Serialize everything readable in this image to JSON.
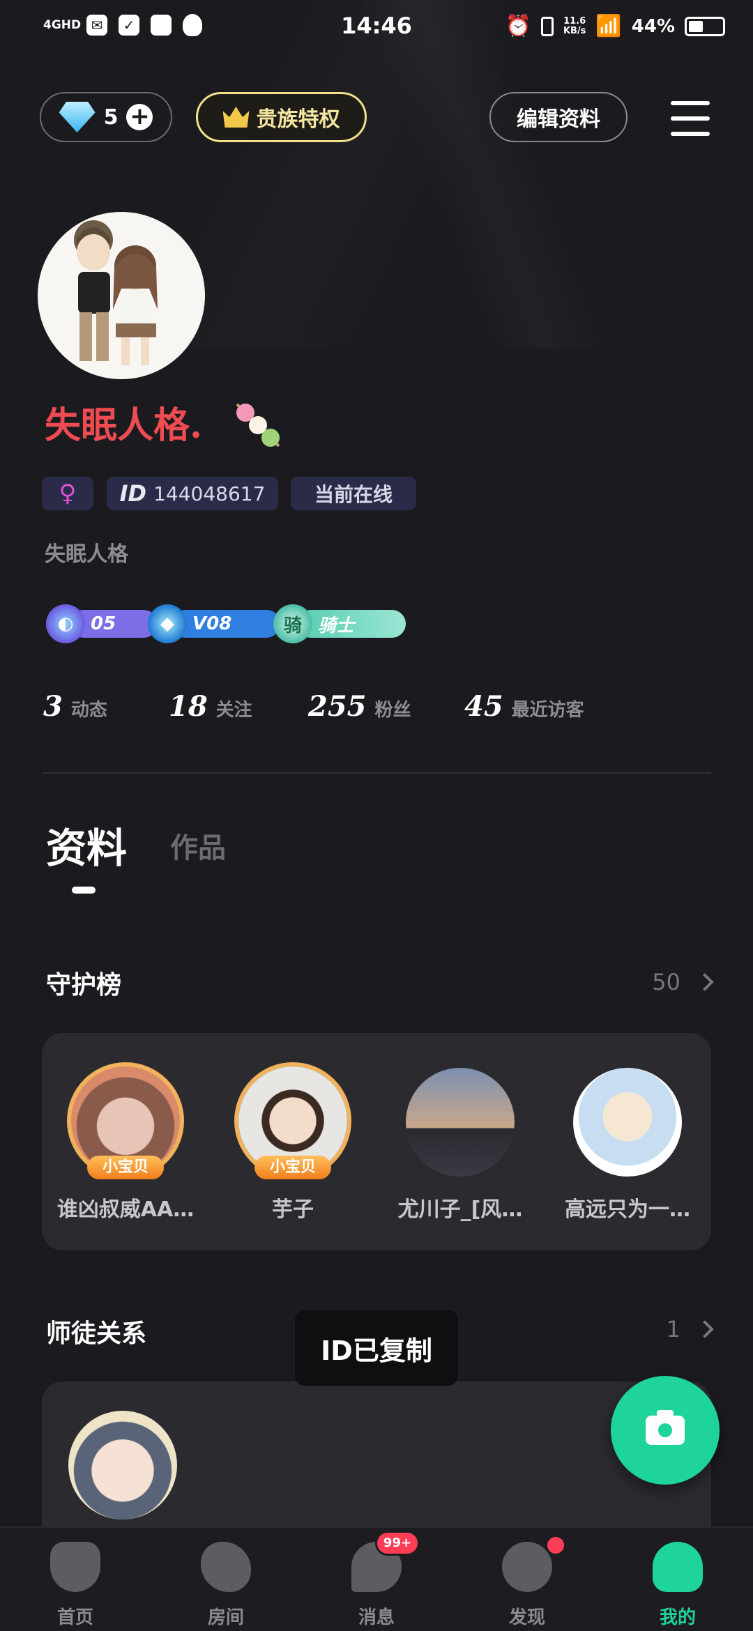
{
  "status_bar": {
    "network": "4GHD",
    "time": "14:46",
    "speed_value": "11.6",
    "speed_unit": "KB/s",
    "battery": "44%",
    "battery_level": 0.44
  },
  "header": {
    "diamond_count": "5",
    "noble_label": "贵族特权",
    "edit_label": "编辑资料"
  },
  "profile": {
    "nickname": "失眠人格.",
    "gender_symbol": "♀",
    "id_prefix": "ID",
    "id_value": "144048617",
    "online_status": "当前在线",
    "signature": "失眠人格",
    "badges": [
      {
        "label": "05"
      },
      {
        "label": "V08"
      },
      {
        "emblem": "骑",
        "label": "骑士"
      }
    ],
    "stats": [
      {
        "value": "3",
        "label": "动态"
      },
      {
        "value": "18",
        "label": "关注"
      },
      {
        "value": "255",
        "label": "粉丝"
      },
      {
        "value": "45",
        "label": "最近访客"
      }
    ]
  },
  "tabs": [
    {
      "label": "资料",
      "active": true
    },
    {
      "label": "作品",
      "active": false
    }
  ],
  "guard_section": {
    "title": "守护榜",
    "count": "50",
    "members": [
      {
        "name": "谁凶叔威AA…",
        "ribbon": "小宝贝"
      },
      {
        "name": "芋子",
        "ribbon": "小宝贝"
      },
      {
        "name": "尤川子_[风…",
        "ribbon": ""
      },
      {
        "name": "高远只为一…",
        "ribbon": ""
      }
    ]
  },
  "mentor_section": {
    "title": "师徒关系",
    "count": "1"
  },
  "toast": "ID已复制",
  "bottom_nav": [
    {
      "label": "首页",
      "icon": "mask-icon"
    },
    {
      "label": "房间",
      "icon": "room-icon"
    },
    {
      "label": "消息",
      "icon": "message-icon",
      "badge": "99+"
    },
    {
      "label": "发现",
      "icon": "planet-icon"
    },
    {
      "label": "我的",
      "icon": "profile-icon"
    }
  ],
  "colors": {
    "background": "#1b1b1f",
    "accent": "#1ed49a",
    "nickname": "#ee4b52",
    "noble_gold": "#f2e08a",
    "badge_red": "#ff3d57"
  }
}
